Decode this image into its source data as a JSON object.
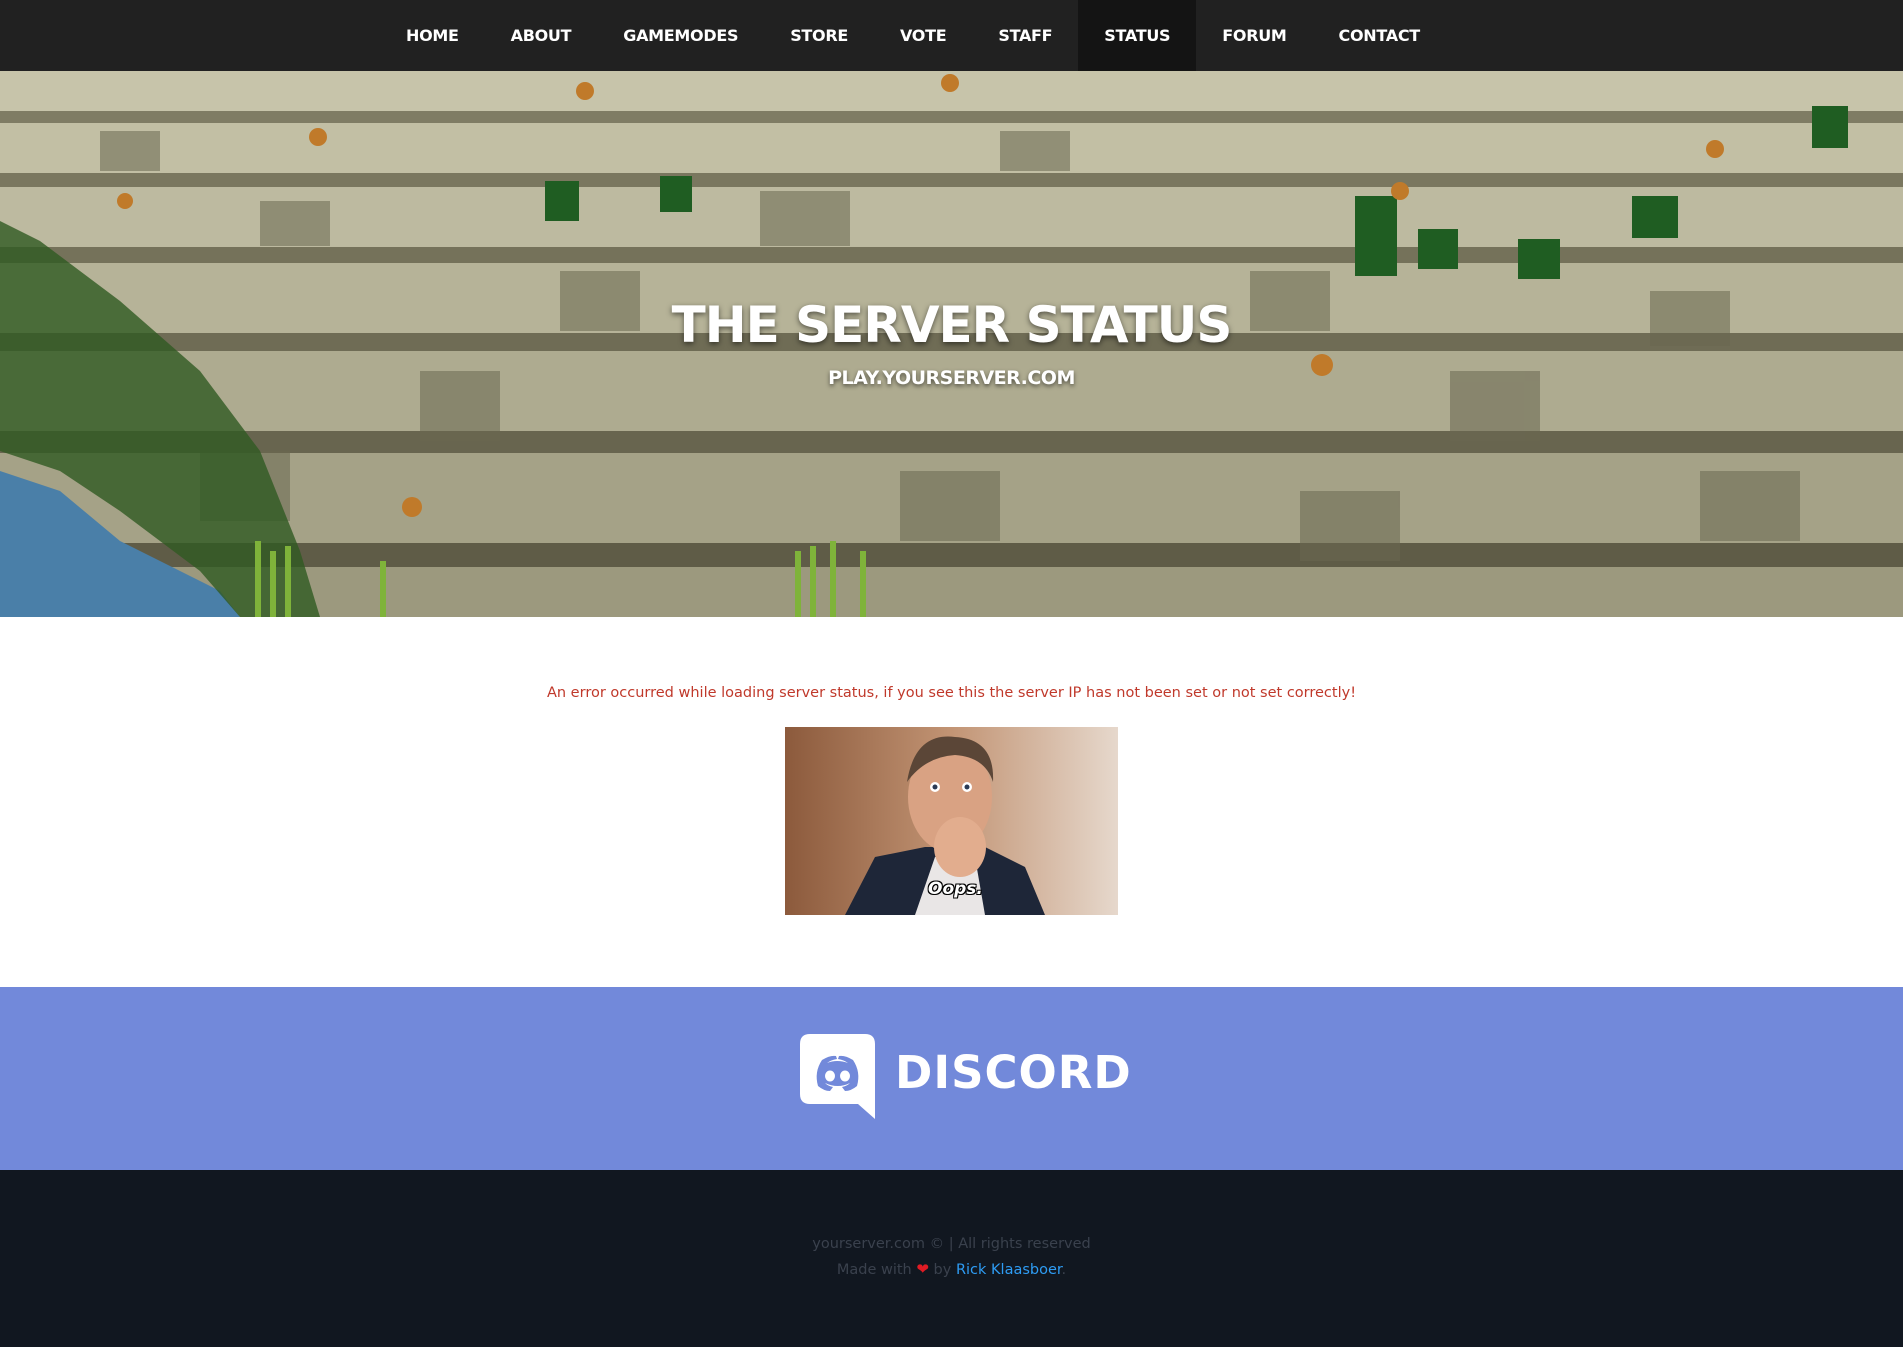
{
  "nav": {
    "items": [
      {
        "label": "HOME"
      },
      {
        "label": "ABOUT"
      },
      {
        "label": "GAMEMODES"
      },
      {
        "label": "STORE"
      },
      {
        "label": "VOTE"
      },
      {
        "label": "STAFF"
      },
      {
        "label": "STATUS",
        "active": true
      },
      {
        "label": "FORUM"
      },
      {
        "label": "CONTACT"
      }
    ]
  },
  "hero": {
    "title": "THE SERVER STATUS",
    "subtitle": "PLAY.YOURSERVER.COM"
  },
  "status": {
    "error_message": "An error occurred while loading server status, if you see this the server IP has not been set or not set correctly!",
    "image_caption": "Oops."
  },
  "discord": {
    "wordmark": "DISCORD"
  },
  "footer": {
    "copyright": "yourserver.com © | All rights reserved",
    "made_with": "Made with",
    "by": "by",
    "author": "Rick Klaasboer",
    "suffix": "."
  },
  "colors": {
    "nav_bg": "#212121",
    "nav_active_bg": "#141414",
    "error_text": "#c0392b",
    "discord_bg": "#7289da",
    "footer_bg": "#111720",
    "footer_text": "#3a414d",
    "link": "#2e9cf4",
    "heart": "#e01b24"
  }
}
